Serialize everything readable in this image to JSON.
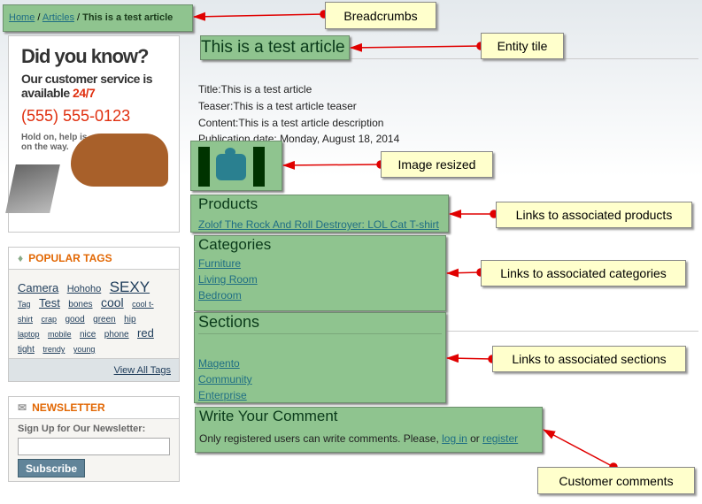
{
  "breadcrumb": {
    "home": "Home",
    "articles": "Articles",
    "current": "This is a test article",
    "sep": " / "
  },
  "title": "This is a test article",
  "fields": [
    "Title:This is a test article",
    "Teaser:This is a test article teaser",
    "Content:This is a test article description",
    "Publication date: Monday, August 18, 2014"
  ],
  "products": {
    "heading": "Products",
    "links": [
      "Zolof The Rock And Roll Destroyer: LOL Cat T-shirt"
    ]
  },
  "categories": {
    "heading": "Categories",
    "links": [
      "Furniture",
      "Living Room",
      "Bedroom"
    ]
  },
  "sections": {
    "heading": "Sections",
    "links": [
      "Magento",
      "Community",
      "Enterprise"
    ]
  },
  "comment": {
    "heading": "Write Your Comment",
    "text": "Only registered users can write comments. Please, ",
    "login": "log in",
    "or": " or ",
    "register": "register"
  },
  "banner": {
    "headline": "Did you know?",
    "line1": "Our customer service is",
    "line2": "available ",
    "avail": "24/7",
    "phone": "(555) 555-0123",
    "hold1": "Hold on, help is",
    "hold2": "on the way."
  },
  "tags": {
    "heading": "POPULAR TAGS",
    "items": [
      [
        "Camera",
        13
      ],
      [
        "Hohoho",
        11
      ],
      [
        "SEXY",
        17
      ],
      [
        "Tag",
        9
      ],
      [
        "Test",
        13
      ],
      [
        "bones",
        10
      ],
      [
        "cool",
        14
      ],
      [
        "cool t-shirt",
        9
      ],
      [
        "crap",
        9
      ],
      [
        "good",
        10
      ],
      [
        "green",
        10
      ],
      [
        "hip",
        10
      ],
      [
        "laptop",
        9
      ],
      [
        "mobile",
        9
      ],
      [
        "nice",
        10
      ],
      [
        "phone",
        10
      ],
      [
        "red",
        13
      ],
      [
        "tight",
        10
      ],
      [
        "trendy",
        9
      ],
      [
        "young",
        9
      ]
    ],
    "view_all": "View All Tags"
  },
  "newsletter": {
    "heading": "NEWSLETTER",
    "label": "Sign Up for Our Newsletter:",
    "value": "",
    "button": "Subscribe"
  },
  "callouts": {
    "breadcrumbs": "Breadcrumbs",
    "entity": "Entity tile",
    "image": "Image resized",
    "products": "Links to associated products",
    "categories": "Links to associated categories",
    "sections": "Links to associated sections",
    "comments": "Customer comments"
  },
  "colors": {
    "highlight": "#8fc48f",
    "callout": "#ffffcc",
    "arrow": "#e00000",
    "orange": "#e26703"
  }
}
